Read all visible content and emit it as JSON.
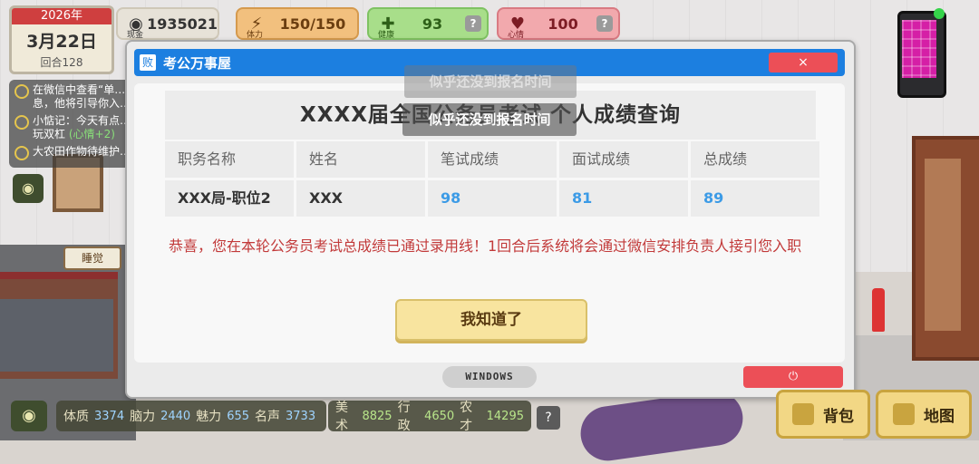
{
  "calendar": {
    "year": "2026年",
    "date": "3月22日",
    "round": "回合128"
  },
  "hud": {
    "money": {
      "value": "1935021",
      "label": "现金"
    },
    "stamina": {
      "value": "150/150",
      "label": "体力"
    },
    "health": {
      "value": "93",
      "label": "健康"
    },
    "mood": {
      "value": "100",
      "label": "心情"
    },
    "help": "?"
  },
  "notes": [
    {
      "text": "在微信中查看“单…息，他将引导你入…",
      "highlight": ""
    },
    {
      "text": "小惦记：今天有点…玩双杠 ",
      "highlight": "(心情+2)"
    },
    {
      "text": "大农田作物待维护…",
      "highlight": ""
    }
  ],
  "room": {
    "sleep_label": "睡觉"
  },
  "window": {
    "app_icon": "败",
    "title": "考公万事屋",
    "close": "×",
    "result_title": "XXXX届全国公务员考试 个人成绩查询",
    "columns": [
      "职务名称",
      "姓名",
      "笔试成绩",
      "面试成绩",
      "总成绩"
    ],
    "row": {
      "position": "XXX局-职位2",
      "name": "XXX",
      "written": "98",
      "interview": "81",
      "total": "89"
    },
    "message": "恭喜，您在本轮公务员考试总成绩已通过录用线！1回合后系统将会通过微信安排负责人接引您入职",
    "ok_button": "我知道了",
    "os_label": "WINDOWS",
    "power_icon": "⏻"
  },
  "toasts": {
    "first": "似乎还没到报名时间",
    "second": "似乎还没到报名时间"
  },
  "attributes": {
    "group1": [
      {
        "name": "体质",
        "value": "3374"
      },
      {
        "name": "脑力",
        "value": "2440"
      },
      {
        "name": "魅力",
        "value": "655"
      },
      {
        "name": "名声",
        "value": "3733"
      }
    ],
    "group2": [
      {
        "name": "美术",
        "value": "8825"
      },
      {
        "name": "行政",
        "value": "4650"
      },
      {
        "name": "农才",
        "value": "14295"
      }
    ],
    "help": "?"
  },
  "buttons": {
    "bag": "背包",
    "map": "地图"
  },
  "colors": {
    "titlebar": "#1c7fe0",
    "score": "#3c9be6",
    "message": "#c23a3a",
    "close": "#ec4f57"
  }
}
